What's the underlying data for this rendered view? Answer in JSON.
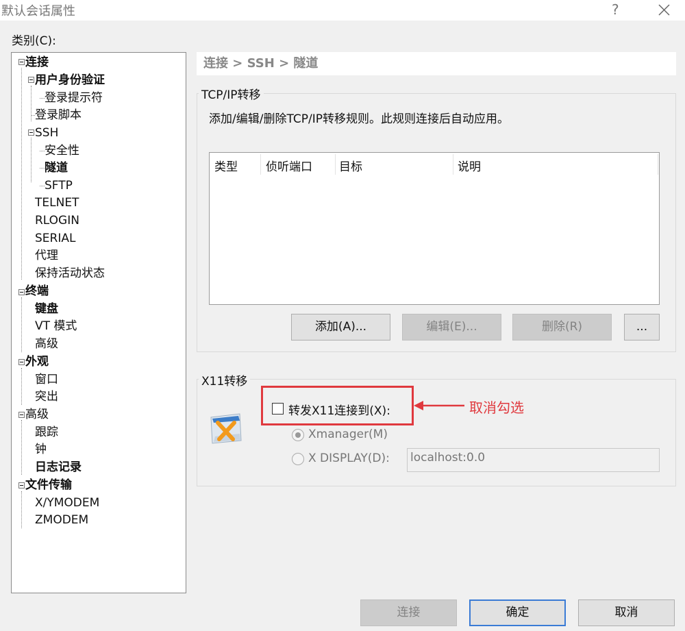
{
  "window": {
    "title": "默认会话属性",
    "help_symbol": "?"
  },
  "category_label": "类别(C):",
  "tree": {
    "items": [
      {
        "label": "连接"
      },
      {
        "label": "用户身份验证"
      },
      {
        "label": "登录提示符"
      },
      {
        "label": "登录脚本"
      },
      {
        "label": "SSH"
      },
      {
        "label": "安全性"
      },
      {
        "label": "隧道"
      },
      {
        "label": "SFTP"
      },
      {
        "label": "TELNET"
      },
      {
        "label": "RLOGIN"
      },
      {
        "label": "SERIAL"
      },
      {
        "label": "代理"
      },
      {
        "label": "保持活动状态"
      },
      {
        "label": "终端"
      },
      {
        "label": "键盘"
      },
      {
        "label": "VT 模式"
      },
      {
        "label": "高级"
      },
      {
        "label": "外观"
      },
      {
        "label": "窗口"
      },
      {
        "label": "突出"
      },
      {
        "label": "高级"
      },
      {
        "label": "跟踪"
      },
      {
        "label": "钟"
      },
      {
        "label": "日志记录"
      },
      {
        "label": "文件传输"
      },
      {
        "label": "X/YMODEM"
      },
      {
        "label": "ZMODEM"
      }
    ]
  },
  "breadcrumb": "连接 > SSH > 隧道",
  "tcpip": {
    "group_title": "TCP/IP转移",
    "description": "添加/编辑/删除TCP/IP转移规则。此规则连接后自动应用。",
    "columns": [
      "类型",
      "侦听端口",
      "目标",
      "说明"
    ],
    "buttons": {
      "add": "添加(A)...",
      "edit": "编辑(E)...",
      "delete": "删除(R)",
      "more": "..."
    }
  },
  "x11": {
    "group_title": "X11转移",
    "checkbox_label": "转发X11连接到(X):",
    "checkbox_checked": false,
    "radio_xmanager": "Xmanager(M)",
    "radio_xdisplay": "X DISPLAY(D):",
    "display_value": "localhost:0.0"
  },
  "annotation": {
    "text": "取消勾选",
    "color": "#e0393e"
  },
  "footer": {
    "connect": "连接",
    "ok": "确定",
    "cancel": "取消"
  }
}
